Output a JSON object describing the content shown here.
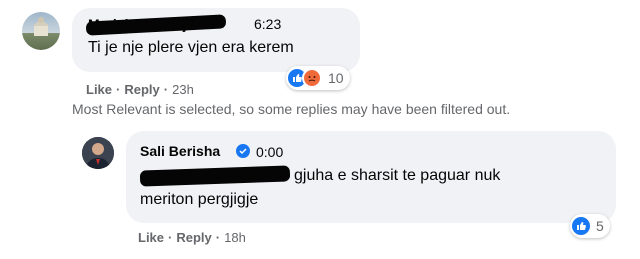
{
  "comment": {
    "author": "Marjalen Hanaj",
    "time": "6:23",
    "text": "Ti je nje plere vjen era kerem",
    "actions": {
      "like": "Like",
      "reply": "Reply",
      "age": "23h"
    },
    "reactions": {
      "count": "10",
      "icons": [
        "like-icon",
        "angry-icon"
      ]
    }
  },
  "filter_notice": "Most Relevant is selected, so some replies may have been filtered out.",
  "reply": {
    "author": "Sali Berisha",
    "verified": true,
    "time": "0:00",
    "text_line1": "gjuha e sharsit te paguar nuk",
    "text_line2": "meriton pergjigje",
    "actions": {
      "like": "Like",
      "reply": "Reply",
      "age": "18h"
    },
    "reactions": {
      "count": "5",
      "icons": [
        "like-icon"
      ]
    }
  },
  "colors": {
    "bubble": "#f0f2f5",
    "like": "#1877f2",
    "muted": "#65676b",
    "angry": "#f0693b"
  }
}
